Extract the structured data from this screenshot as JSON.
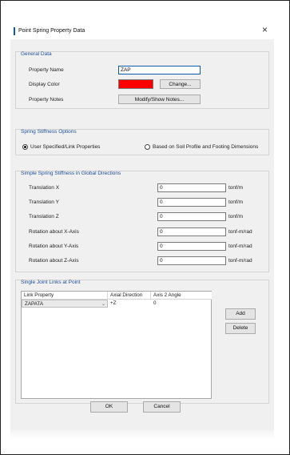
{
  "window": {
    "title": "Point Spring Property Data",
    "close_glyph": "×"
  },
  "general": {
    "label": "General Data",
    "property_name_label": "Property Name",
    "property_name_value": "ZAP",
    "display_color_label": "Display Color",
    "display_color": "#ff0000",
    "change_button": "Change...",
    "property_notes_label": "Property Notes",
    "notes_button": "Modify/Show Notes..."
  },
  "stiffness_options": {
    "label": "Spring Stiffness Options",
    "option_user": "User Specified/Link Properties",
    "option_soil": "Based on Soil Profile and Footing Dimensions",
    "selected": "user"
  },
  "simple_spring": {
    "label": "Simple Spring Stiffness in Global Directions",
    "rows": [
      {
        "label": "Translation X",
        "value": "0",
        "unit": "tonf/m"
      },
      {
        "label": "Translation Y",
        "value": "0",
        "unit": "tonf/m"
      },
      {
        "label": "Translation Z",
        "value": "0",
        "unit": "tonf/m"
      },
      {
        "label": "Rotation about X-Axis",
        "value": "0",
        "unit": "tonf-m/rad"
      },
      {
        "label": "Rotation about Y-Axis",
        "value": "0",
        "unit": "tonf-m/rad"
      },
      {
        "label": "Rotation about Z-Axis",
        "value": "0",
        "unit": "tonf-m/rad"
      }
    ]
  },
  "links": {
    "label": "Single Joint Links at Point",
    "columns": [
      "Link Property",
      "Axial Direction",
      "Axis 2 Angle"
    ],
    "rows": [
      {
        "property": "ZAPATA",
        "direction": "+Z",
        "angle": "0"
      }
    ],
    "add_button": "Add",
    "delete_button": "Delete"
  },
  "footer": {
    "ok_button": "OK",
    "cancel_button": "Cancel"
  }
}
